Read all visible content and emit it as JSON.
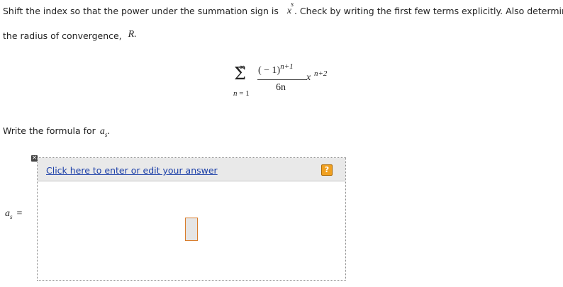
{
  "question": {
    "line1_text": "Shift the index so that the power under the summation sign is",
    "power_base": "x",
    "power_exp": "s",
    "line1_text_after": ". Check by writing the first few terms explicitly. Also determine",
    "line2_text": "the radius of convergence,",
    "radius_var": "R."
  },
  "series": {
    "upper": "∞",
    "sigma": "Σ",
    "lower_var": "n",
    "lower_val": "= 1",
    "numerator_base": "( − 1)",
    "numerator_exp": "n+1",
    "denominator": "6n",
    "x": "x",
    "x_exp": "n+2"
  },
  "prompt": {
    "text": "Write the formula for",
    "var": "a",
    "sub": "s",
    "end": "."
  },
  "editor": {
    "close_icon": "×",
    "link_text": "Click here to enter or edit your answer",
    "help_text": "?",
    "label_var": "a",
    "label_sub": "s",
    "label_eq": "="
  }
}
